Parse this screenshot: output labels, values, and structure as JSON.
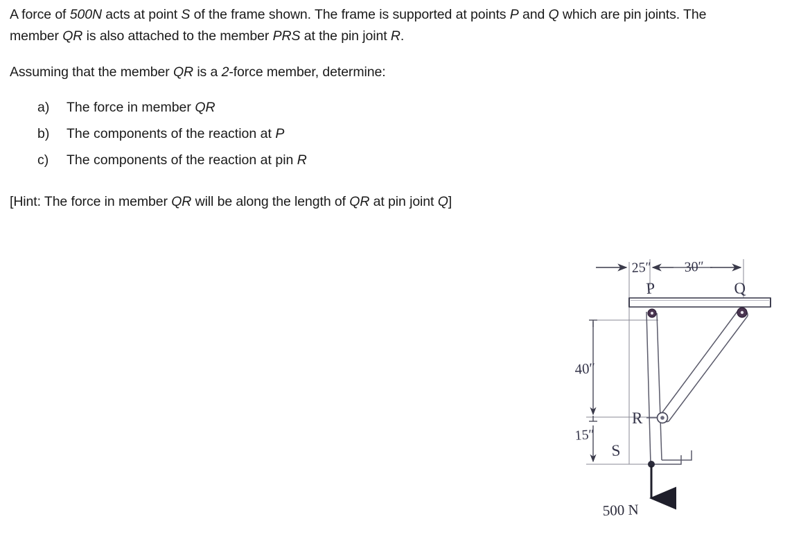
{
  "problem": {
    "paragraph1_part1": "A force of ",
    "paragraph1_force": "500N",
    "paragraph1_part2": " acts at point ",
    "paragraph1_s": "S",
    "paragraph1_part3": " of the frame shown.  The frame is supported at points ",
    "paragraph1_p": "P",
    "paragraph1_part4": " and ",
    "paragraph1_q": "Q",
    "paragraph1_part5": " which are pin joints.  The member ",
    "paragraph1_qr": "QR",
    "paragraph1_part6": " is also attached to the member ",
    "paragraph1_prs": "PRS",
    "paragraph1_part7": " at the pin joint ",
    "paragraph1_r": "R",
    "paragraph1_part8": ".",
    "paragraph2_part1": "Assuming that the member ",
    "paragraph2_qr": "QR",
    "paragraph2_part2": " is a ",
    "paragraph2_two": "2",
    "paragraph2_part3": "-force member, determine:",
    "questions": [
      {
        "marker": "a)",
        "text_part1": "The force in member ",
        "text_italic": "QR",
        "text_part2": ""
      },
      {
        "marker": "b)",
        "text_part1": "The components of the reaction at ",
        "text_italic": "P",
        "text_part2": ""
      },
      {
        "marker": "c)",
        "text_part1": "The components of the reaction at pin ",
        "text_italic": "R",
        "text_part2": ""
      }
    ],
    "hint_part1": "[Hint:  The force in member ",
    "hint_qr1": "QR",
    "hint_part2": " will be along the length of ",
    "hint_qr2": "QR",
    "hint_part3": " at pin joint ",
    "hint_q": "Q",
    "hint_part4": "]"
  },
  "figure": {
    "dimensions": {
      "top_left": "25″",
      "top_right": "30″",
      "vertical_upper": "40″",
      "vertical_lower": "15″"
    },
    "point_labels": {
      "p": "P",
      "q": "Q",
      "r": "R",
      "s": "S"
    },
    "load_label": "500 N",
    "colors": {
      "ink": "#3c3c4e",
      "line": "#5a5a6a",
      "pin": "#4a3550",
      "arrow": "#2b2b3a"
    }
  }
}
